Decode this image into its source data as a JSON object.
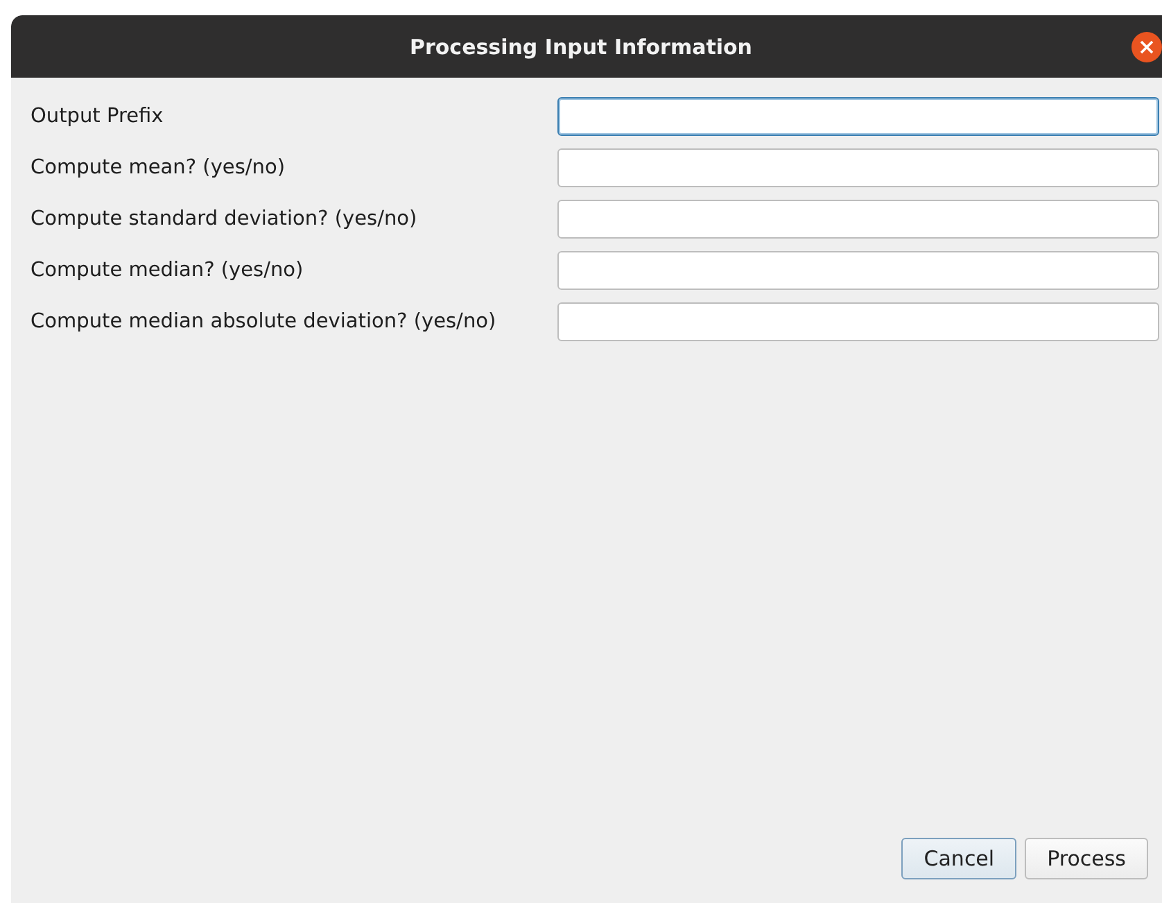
{
  "window": {
    "title": "Processing Input Information"
  },
  "fields": [
    {
      "label": "Output Prefix",
      "focused": true
    },
    {
      "label": "Compute mean? (yes/no)",
      "focused": false
    },
    {
      "label": "Compute standard deviation? (yes/no)",
      "focused": false
    },
    {
      "label": "Compute median? (yes/no)",
      "focused": false
    },
    {
      "label": "Compute median absolute deviation? (yes/no)",
      "focused": false
    }
  ],
  "buttons": [
    {
      "label": "Cancel",
      "focused": true
    },
    {
      "label": "Process",
      "focused": false
    }
  ]
}
